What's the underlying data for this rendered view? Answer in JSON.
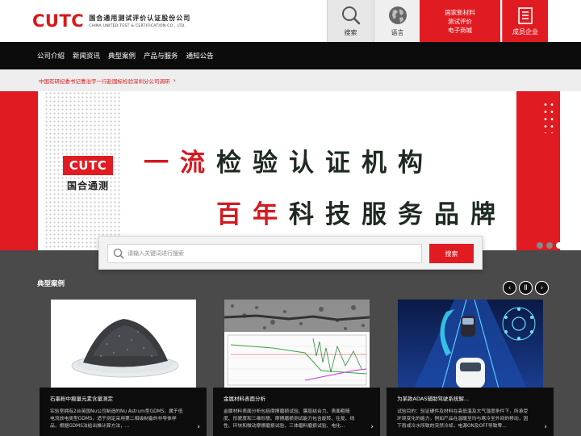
{
  "header": {
    "logo_mark": "CUTC",
    "logo_cn": "国合通用测试评价认证股份公司",
    "logo_en": "CHINA UNITED TEST & CERTIFICATION CO., LTD.",
    "search_label": "搜索",
    "language_label": "语言",
    "quick_links": [
      "国家新材料",
      "测试评价",
      "电子商城"
    ],
    "members_label": "成员企业"
  },
  "nav": {
    "items": [
      "公司介绍",
      "新闻资讯",
      "典型案例",
      "产品与服务",
      "通知公告"
    ]
  },
  "notice": {
    "text": "中国有研纪委书记曹治宇一行赴国标检验深圳分公司调研",
    "arrow": "›"
  },
  "banner": {
    "logo_mark": "CUTC",
    "logo_cn": "国合通测",
    "slogan_line1_red": "一流",
    "slogan_line1_dark": "检验认证机构",
    "slogan_line2_red": "百年",
    "slogan_line2_dark": "科技服务品牌",
    "slide_count": 3,
    "active_slide": 3
  },
  "search": {
    "placeholder": "请输入关键词进行搜索",
    "button": "搜索"
  },
  "cases": {
    "title": "典型案例",
    "prev": "‹",
    "pause": "Ⅱ",
    "next": "›",
    "cards": [
      {
        "title": "石墨粉中痕量元素含量测定",
        "desc": "实验室拥有2台英国Nu公司制造的Nu Astrum型GDMS，属于低电流放电类型GDMS，适于测定采用第二相级制备的非导体样品，根据GDMS法给出推计算方法，..."
      },
      {
        "title": "金属材料表面分析",
        "desc": "金属材料表面分析包括摩擦磨损试验、膜层结合力、表面粗糙度、形貌度和三维形貌、摩擦磨损测试能力包含旋转、往复、线性、环块和微动摩擦磨损试验、三体磨料磨损试验、电化..."
      },
      {
        "title": "为某款ADAS辅助驾驶系统解...",
        "desc": "试验目的：验证硬件及材料在高低温及大气湿度条件下，所承受环境变化的能力，例如产品在温暖至均与寒冷至外间的移动，因下雨或冷水所致的突然冷却，电源ON及OFF导致零..."
      }
    ]
  },
  "colors": {
    "brand_red": "#e11b22",
    "nav_bg": "#0c0c0c",
    "cases_bg": "#4a4a4a"
  }
}
